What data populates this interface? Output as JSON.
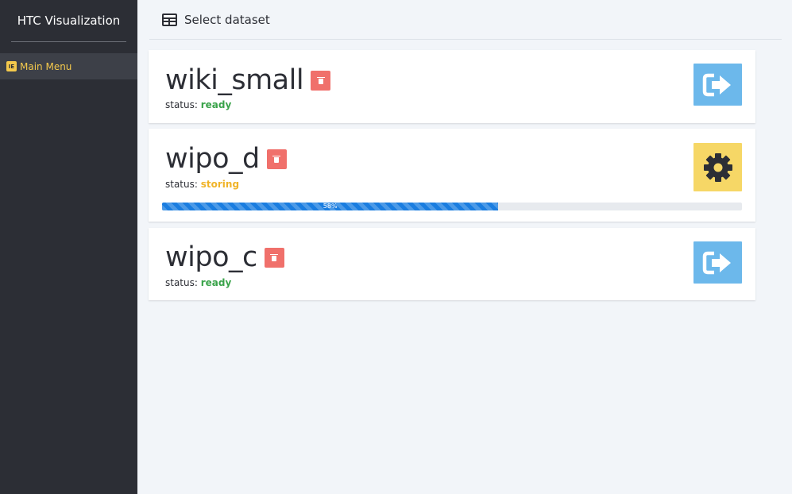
{
  "sidebar": {
    "brand": "HTC Visualization",
    "menu_icon_glyph": "IE",
    "menu_label": "Main Menu",
    "menu_icon": "menu-icon",
    "accent": "#f4c94c"
  },
  "header": {
    "icon": "table-icon",
    "title": "Select dataset"
  },
  "datasets": [
    {
      "name": "wiki_small",
      "status_label": "status:",
      "status": "ready",
      "action": "open-icon"
    },
    {
      "name": "wipo_d",
      "status_label": "status:",
      "status": "storing",
      "action": "gear-icon",
      "progress": 58,
      "progress_text": "58%"
    },
    {
      "name": "wipo_c",
      "status_label": "status:",
      "status": "ready",
      "action": "open-icon"
    }
  ],
  "colors": {
    "ready": "#3aa34a",
    "storing": "#f0b429",
    "delete": "#f0706b",
    "open": "#6cb8eb",
    "gear": "#f6d766",
    "progress": "#1a7de0"
  }
}
